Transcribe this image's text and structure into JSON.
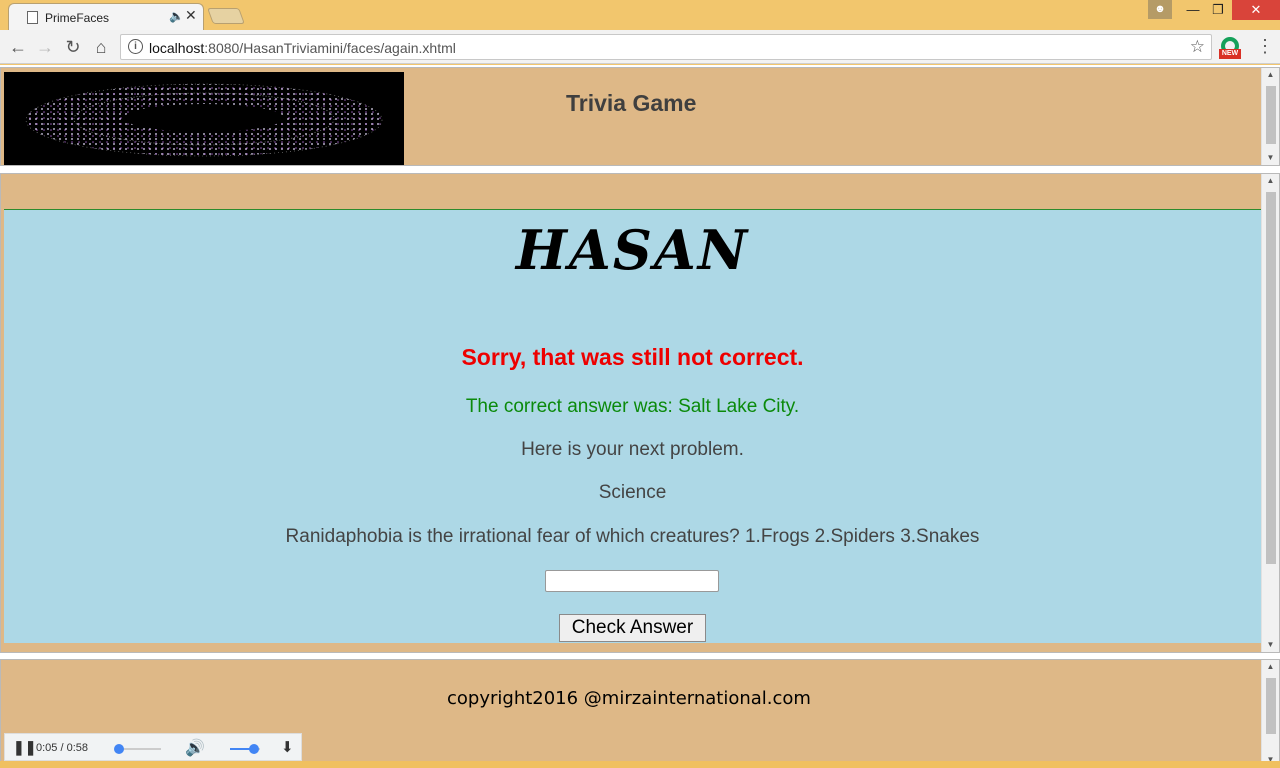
{
  "browser": {
    "tab_title": "PrimeFaces",
    "url_host": "localhost",
    "url_rest": ":8080/HasanTriviamini/faces/again.xhtml",
    "ext_badge": "NEW"
  },
  "header": {
    "title": "Trivia Game"
  },
  "main": {
    "banner": "HASAN",
    "result_message": "Sorry, that was still not correct.",
    "correct_answer": "The correct answer was: Salt Lake City.",
    "next_prompt": "Here is your next problem.",
    "category": "Science",
    "question": "Ranidaphobia is the irrational fear of which creatures? 1.Frogs 2.Spiders 3.Snakes",
    "answer_value": "",
    "check_button_label": "Check Answer"
  },
  "footer": {
    "copyright": "copyright2016 @mirzainternational.com"
  },
  "audio": {
    "time": "0:05 / 0:58",
    "progress": 0.086,
    "volume": 0.8
  },
  "colors": {
    "frame_bg": "#deb887",
    "content_bg": "#add8e6",
    "error_text": "#ee0000",
    "success_text": "#0b8a0b"
  }
}
